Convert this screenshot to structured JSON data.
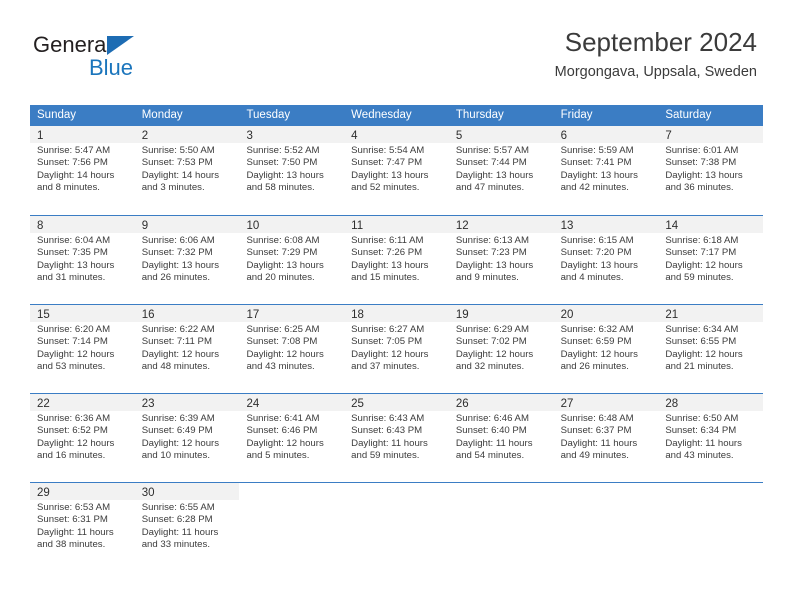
{
  "logo": {
    "word_top": "General",
    "word_bottom": "Blue",
    "triangle_color": "#1d6cb3",
    "blue_color": "#1b75bc"
  },
  "header": {
    "title": "September 2024",
    "subtitle": "Morgongava, Uppsala, Sweden"
  },
  "theme": {
    "header_blue": "#3b7dc4",
    "daynum_band": "#f2f2f2",
    "text": "#3c3c3c"
  },
  "weekdays": [
    "Sunday",
    "Monday",
    "Tuesday",
    "Wednesday",
    "Thursday",
    "Friday",
    "Saturday"
  ],
  "weeks": [
    [
      {
        "day": "1",
        "sunrise": "Sunrise: 5:47 AM",
        "sunset": "Sunset: 7:56 PM",
        "daylight1": "Daylight: 14 hours",
        "daylight2": "and 8 minutes."
      },
      {
        "day": "2",
        "sunrise": "Sunrise: 5:50 AM",
        "sunset": "Sunset: 7:53 PM",
        "daylight1": "Daylight: 14 hours",
        "daylight2": "and 3 minutes."
      },
      {
        "day": "3",
        "sunrise": "Sunrise: 5:52 AM",
        "sunset": "Sunset: 7:50 PM",
        "daylight1": "Daylight: 13 hours",
        "daylight2": "and 58 minutes."
      },
      {
        "day": "4",
        "sunrise": "Sunrise: 5:54 AM",
        "sunset": "Sunset: 7:47 PM",
        "daylight1": "Daylight: 13 hours",
        "daylight2": "and 52 minutes."
      },
      {
        "day": "5",
        "sunrise": "Sunrise: 5:57 AM",
        "sunset": "Sunset: 7:44 PM",
        "daylight1": "Daylight: 13 hours",
        "daylight2": "and 47 minutes."
      },
      {
        "day": "6",
        "sunrise": "Sunrise: 5:59 AM",
        "sunset": "Sunset: 7:41 PM",
        "daylight1": "Daylight: 13 hours",
        "daylight2": "and 42 minutes."
      },
      {
        "day": "7",
        "sunrise": "Sunrise: 6:01 AM",
        "sunset": "Sunset: 7:38 PM",
        "daylight1": "Daylight: 13 hours",
        "daylight2": "and 36 minutes."
      }
    ],
    [
      {
        "day": "8",
        "sunrise": "Sunrise: 6:04 AM",
        "sunset": "Sunset: 7:35 PM",
        "daylight1": "Daylight: 13 hours",
        "daylight2": "and 31 minutes."
      },
      {
        "day": "9",
        "sunrise": "Sunrise: 6:06 AM",
        "sunset": "Sunset: 7:32 PM",
        "daylight1": "Daylight: 13 hours",
        "daylight2": "and 26 minutes."
      },
      {
        "day": "10",
        "sunrise": "Sunrise: 6:08 AM",
        "sunset": "Sunset: 7:29 PM",
        "daylight1": "Daylight: 13 hours",
        "daylight2": "and 20 minutes."
      },
      {
        "day": "11",
        "sunrise": "Sunrise: 6:11 AM",
        "sunset": "Sunset: 7:26 PM",
        "daylight1": "Daylight: 13 hours",
        "daylight2": "and 15 minutes."
      },
      {
        "day": "12",
        "sunrise": "Sunrise: 6:13 AM",
        "sunset": "Sunset: 7:23 PM",
        "daylight1": "Daylight: 13 hours",
        "daylight2": "and 9 minutes."
      },
      {
        "day": "13",
        "sunrise": "Sunrise: 6:15 AM",
        "sunset": "Sunset: 7:20 PM",
        "daylight1": "Daylight: 13 hours",
        "daylight2": "and 4 minutes."
      },
      {
        "day": "14",
        "sunrise": "Sunrise: 6:18 AM",
        "sunset": "Sunset: 7:17 PM",
        "daylight1": "Daylight: 12 hours",
        "daylight2": "and 59 minutes."
      }
    ],
    [
      {
        "day": "15",
        "sunrise": "Sunrise: 6:20 AM",
        "sunset": "Sunset: 7:14 PM",
        "daylight1": "Daylight: 12 hours",
        "daylight2": "and 53 minutes."
      },
      {
        "day": "16",
        "sunrise": "Sunrise: 6:22 AM",
        "sunset": "Sunset: 7:11 PM",
        "daylight1": "Daylight: 12 hours",
        "daylight2": "and 48 minutes."
      },
      {
        "day": "17",
        "sunrise": "Sunrise: 6:25 AM",
        "sunset": "Sunset: 7:08 PM",
        "daylight1": "Daylight: 12 hours",
        "daylight2": "and 43 minutes."
      },
      {
        "day": "18",
        "sunrise": "Sunrise: 6:27 AM",
        "sunset": "Sunset: 7:05 PM",
        "daylight1": "Daylight: 12 hours",
        "daylight2": "and 37 minutes."
      },
      {
        "day": "19",
        "sunrise": "Sunrise: 6:29 AM",
        "sunset": "Sunset: 7:02 PM",
        "daylight1": "Daylight: 12 hours",
        "daylight2": "and 32 minutes."
      },
      {
        "day": "20",
        "sunrise": "Sunrise: 6:32 AM",
        "sunset": "Sunset: 6:59 PM",
        "daylight1": "Daylight: 12 hours",
        "daylight2": "and 26 minutes."
      },
      {
        "day": "21",
        "sunrise": "Sunrise: 6:34 AM",
        "sunset": "Sunset: 6:55 PM",
        "daylight1": "Daylight: 12 hours",
        "daylight2": "and 21 minutes."
      }
    ],
    [
      {
        "day": "22",
        "sunrise": "Sunrise: 6:36 AM",
        "sunset": "Sunset: 6:52 PM",
        "daylight1": "Daylight: 12 hours",
        "daylight2": "and 16 minutes."
      },
      {
        "day": "23",
        "sunrise": "Sunrise: 6:39 AM",
        "sunset": "Sunset: 6:49 PM",
        "daylight1": "Daylight: 12 hours",
        "daylight2": "and 10 minutes."
      },
      {
        "day": "24",
        "sunrise": "Sunrise: 6:41 AM",
        "sunset": "Sunset: 6:46 PM",
        "daylight1": "Daylight: 12 hours",
        "daylight2": "and 5 minutes."
      },
      {
        "day": "25",
        "sunrise": "Sunrise: 6:43 AM",
        "sunset": "Sunset: 6:43 PM",
        "daylight1": "Daylight: 11 hours",
        "daylight2": "and 59 minutes."
      },
      {
        "day": "26",
        "sunrise": "Sunrise: 6:46 AM",
        "sunset": "Sunset: 6:40 PM",
        "daylight1": "Daylight: 11 hours",
        "daylight2": "and 54 minutes."
      },
      {
        "day": "27",
        "sunrise": "Sunrise: 6:48 AM",
        "sunset": "Sunset: 6:37 PM",
        "daylight1": "Daylight: 11 hours",
        "daylight2": "and 49 minutes."
      },
      {
        "day": "28",
        "sunrise": "Sunrise: 6:50 AM",
        "sunset": "Sunset: 6:34 PM",
        "daylight1": "Daylight: 11 hours",
        "daylight2": "and 43 minutes."
      }
    ],
    [
      {
        "day": "29",
        "sunrise": "Sunrise: 6:53 AM",
        "sunset": "Sunset: 6:31 PM",
        "daylight1": "Daylight: 11 hours",
        "daylight2": "and 38 minutes."
      },
      {
        "day": "30",
        "sunrise": "Sunrise: 6:55 AM",
        "sunset": "Sunset: 6:28 PM",
        "daylight1": "Daylight: 11 hours",
        "daylight2": "and 33 minutes."
      },
      {
        "day": "",
        "sunrise": "",
        "sunset": "",
        "daylight1": "",
        "daylight2": ""
      },
      {
        "day": "",
        "sunrise": "",
        "sunset": "",
        "daylight1": "",
        "daylight2": ""
      },
      {
        "day": "",
        "sunrise": "",
        "sunset": "",
        "daylight1": "",
        "daylight2": ""
      },
      {
        "day": "",
        "sunrise": "",
        "sunset": "",
        "daylight1": "",
        "daylight2": ""
      },
      {
        "day": "",
        "sunrise": "",
        "sunset": "",
        "daylight1": "",
        "daylight2": ""
      }
    ]
  ]
}
